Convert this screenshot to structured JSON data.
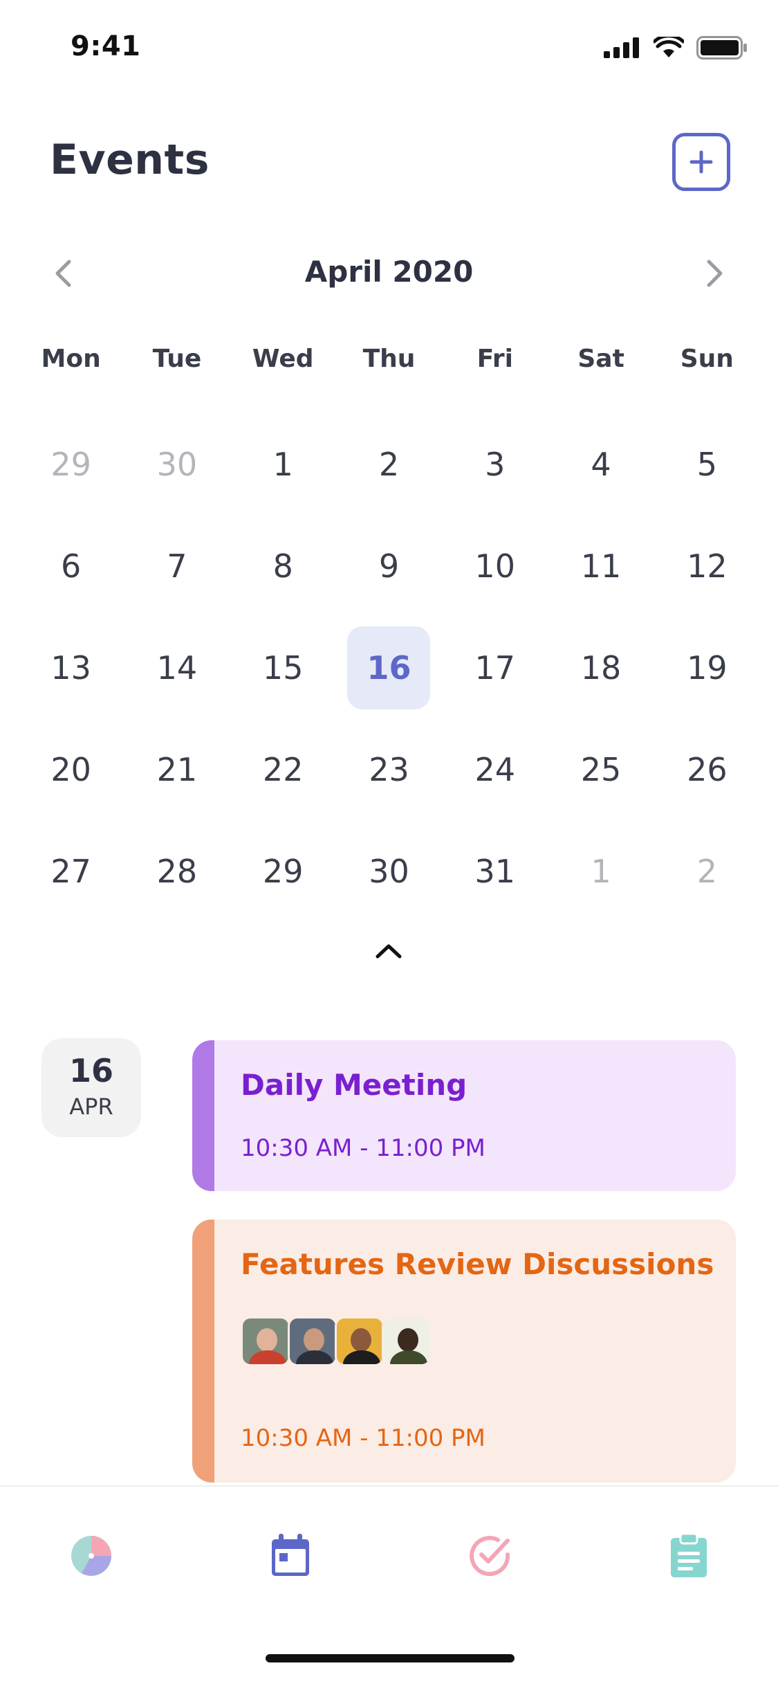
{
  "status_bar": {
    "time": "9:41"
  },
  "header": {
    "title": "Events"
  },
  "calendar": {
    "month_label": "April 2020",
    "weekdays": [
      "Mon",
      "Tue",
      "Wed",
      "Thu",
      "Fri",
      "Sat",
      "Sun"
    ],
    "days": [
      {
        "n": "29",
        "muted": true
      },
      {
        "n": "30",
        "muted": true
      },
      {
        "n": "1"
      },
      {
        "n": "2"
      },
      {
        "n": "3"
      },
      {
        "n": "4"
      },
      {
        "n": "5"
      },
      {
        "n": "6"
      },
      {
        "n": "7"
      },
      {
        "n": "8"
      },
      {
        "n": "9"
      },
      {
        "n": "10"
      },
      {
        "n": "11"
      },
      {
        "n": "12"
      },
      {
        "n": "13"
      },
      {
        "n": "14"
      },
      {
        "n": "15"
      },
      {
        "n": "16",
        "selected": true
      },
      {
        "n": "17"
      },
      {
        "n": "18"
      },
      {
        "n": "19"
      },
      {
        "n": "20"
      },
      {
        "n": "21"
      },
      {
        "n": "22"
      },
      {
        "n": "23"
      },
      {
        "n": "24"
      },
      {
        "n": "25"
      },
      {
        "n": "26"
      },
      {
        "n": "27"
      },
      {
        "n": "28"
      },
      {
        "n": "29"
      },
      {
        "n": "30"
      },
      {
        "n": "31"
      },
      {
        "n": "1",
        "muted": true
      },
      {
        "n": "2",
        "muted": true
      }
    ]
  },
  "events": {
    "date": {
      "day": "16",
      "month": "APR"
    },
    "items": [
      {
        "title": "Daily Meeting",
        "time": "10:30 AM - 11:00 PM",
        "accent": "#b07ae6"
      },
      {
        "title": "Features Review Discussions",
        "time": "10:30 AM - 11:00 PM",
        "accent": "#f0a17a",
        "attendees": 4
      }
    ]
  },
  "tab_bar": {
    "items": [
      {
        "icon": "pie-chart-icon"
      },
      {
        "icon": "calendar-icon",
        "active": true
      },
      {
        "icon": "check-circle-icon"
      },
      {
        "icon": "clipboard-icon"
      }
    ]
  },
  "colors": {
    "accent": "#5c67c7",
    "selected_bg": "#e6e9f7"
  }
}
